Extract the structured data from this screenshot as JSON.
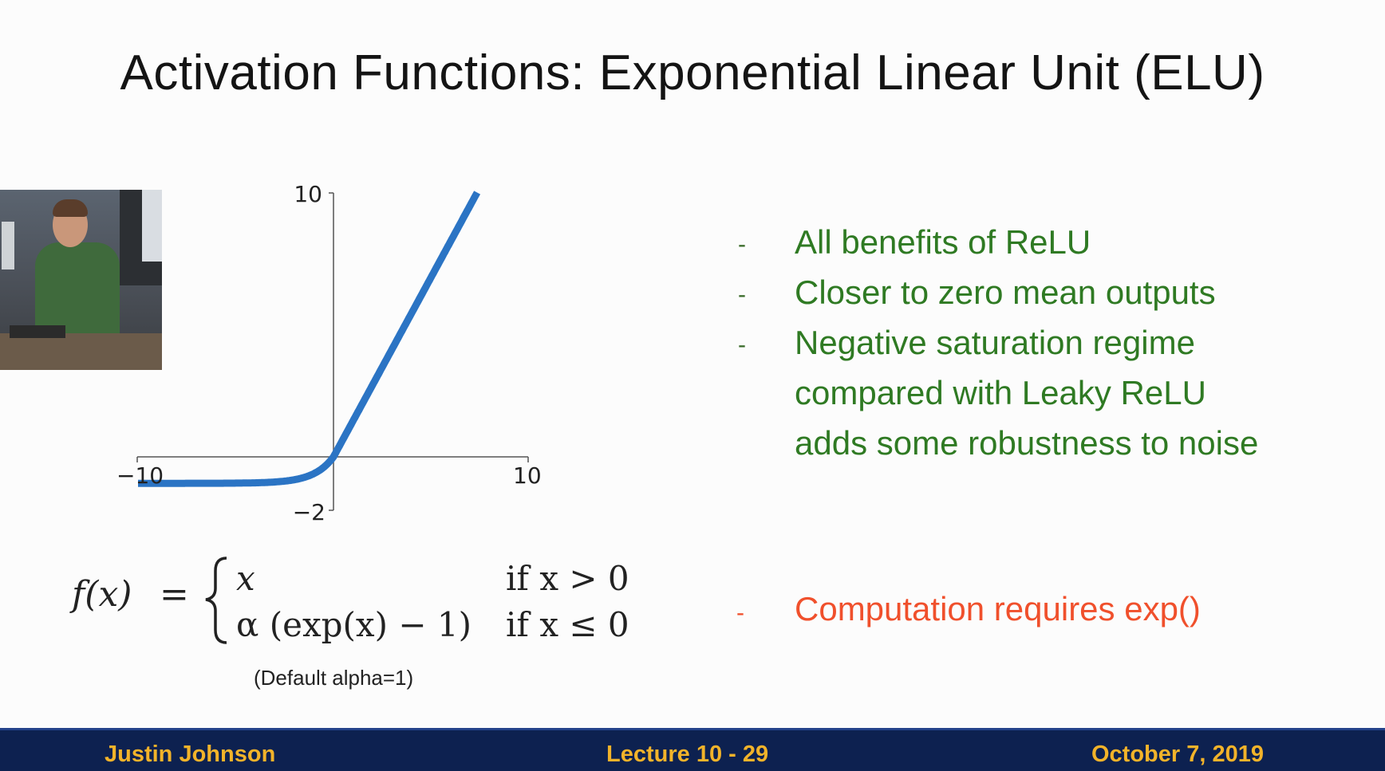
{
  "slide": {
    "title": "Activation Functions: Exponential Linear Unit (ELU)"
  },
  "chart": {
    "y_max_label": "10",
    "y_min_label": "−2",
    "x_min_label": "−10",
    "x_max_label": "10",
    "line_color": "#2b74c4"
  },
  "bullets": {
    "b1": "All benefits of ReLU",
    "b2": "Closer to zero mean outputs",
    "b3_line1": "Negative saturation regime",
    "b3_line2": "compared with Leaky ReLU",
    "b3_line3": "adds some robustness to noise",
    "con": "Computation requires exp()"
  },
  "formula": {
    "lhs": "f(x)",
    "eq": "=",
    "case1_expr": "x",
    "case1_cond": "if x > 0",
    "case2_expr": "α (exp(x) − 1)",
    "case2_cond": "if x ≤ 0",
    "note": "(Default alpha=1)"
  },
  "footer": {
    "author": "Justin Johnson",
    "lecture": "Lecture 10 - 29",
    "date": "October 7, 2019"
  },
  "colors": {
    "pro": "#2f7a23",
    "con": "#f0502c",
    "footer_bg": "#0d2150",
    "footer_text": "#f2b32a"
  }
}
